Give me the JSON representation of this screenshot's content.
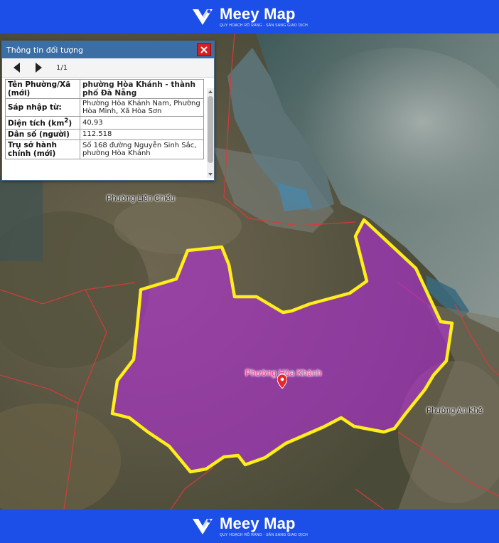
{
  "brand": {
    "name": "Meey Map",
    "tagline": "QUY HOẠCH RÕ RÀNG - SẴN SÀNG GIAO DỊCH"
  },
  "info_panel": {
    "title": "Thông tin đối tượng",
    "pagination": "1/1",
    "rows": [
      {
        "key": "Tên Phường/Xã (mới)",
        "value": "phường Hòa Khánh - thành phố Đà Nẵng"
      },
      {
        "key": "Sáp nhập từ:",
        "value": "Phường Hòa Khánh Nam, Phường Hòa Minh, Xã Hòa Sơn"
      },
      {
        "key_prefix": "Diện tích (km",
        "key_sup": "2",
        "key_suffix": ")",
        "value": "40,93"
      },
      {
        "key": "Dân số (người)",
        "value": "112.518"
      },
      {
        "key": "Trụ sở hành chính (mới)",
        "value": "Số 168 đường Nguyễn Sinh Sắc, phường Hòa Khánh"
      }
    ]
  },
  "map": {
    "labels": {
      "selected_ward": "Phường Hòa Khánh",
      "ward_lien_chieu": "Phường Liên Chiểu",
      "ward_an_khe": "Phường An Khê"
    },
    "colors": {
      "highlight_fill": "#b12fd6",
      "highlight_border": "#ffee1a",
      "boundary": "#d93a3a",
      "pin": "#e8262c",
      "sea": "#4d6462",
      "land": "#5f5a46"
    }
  }
}
